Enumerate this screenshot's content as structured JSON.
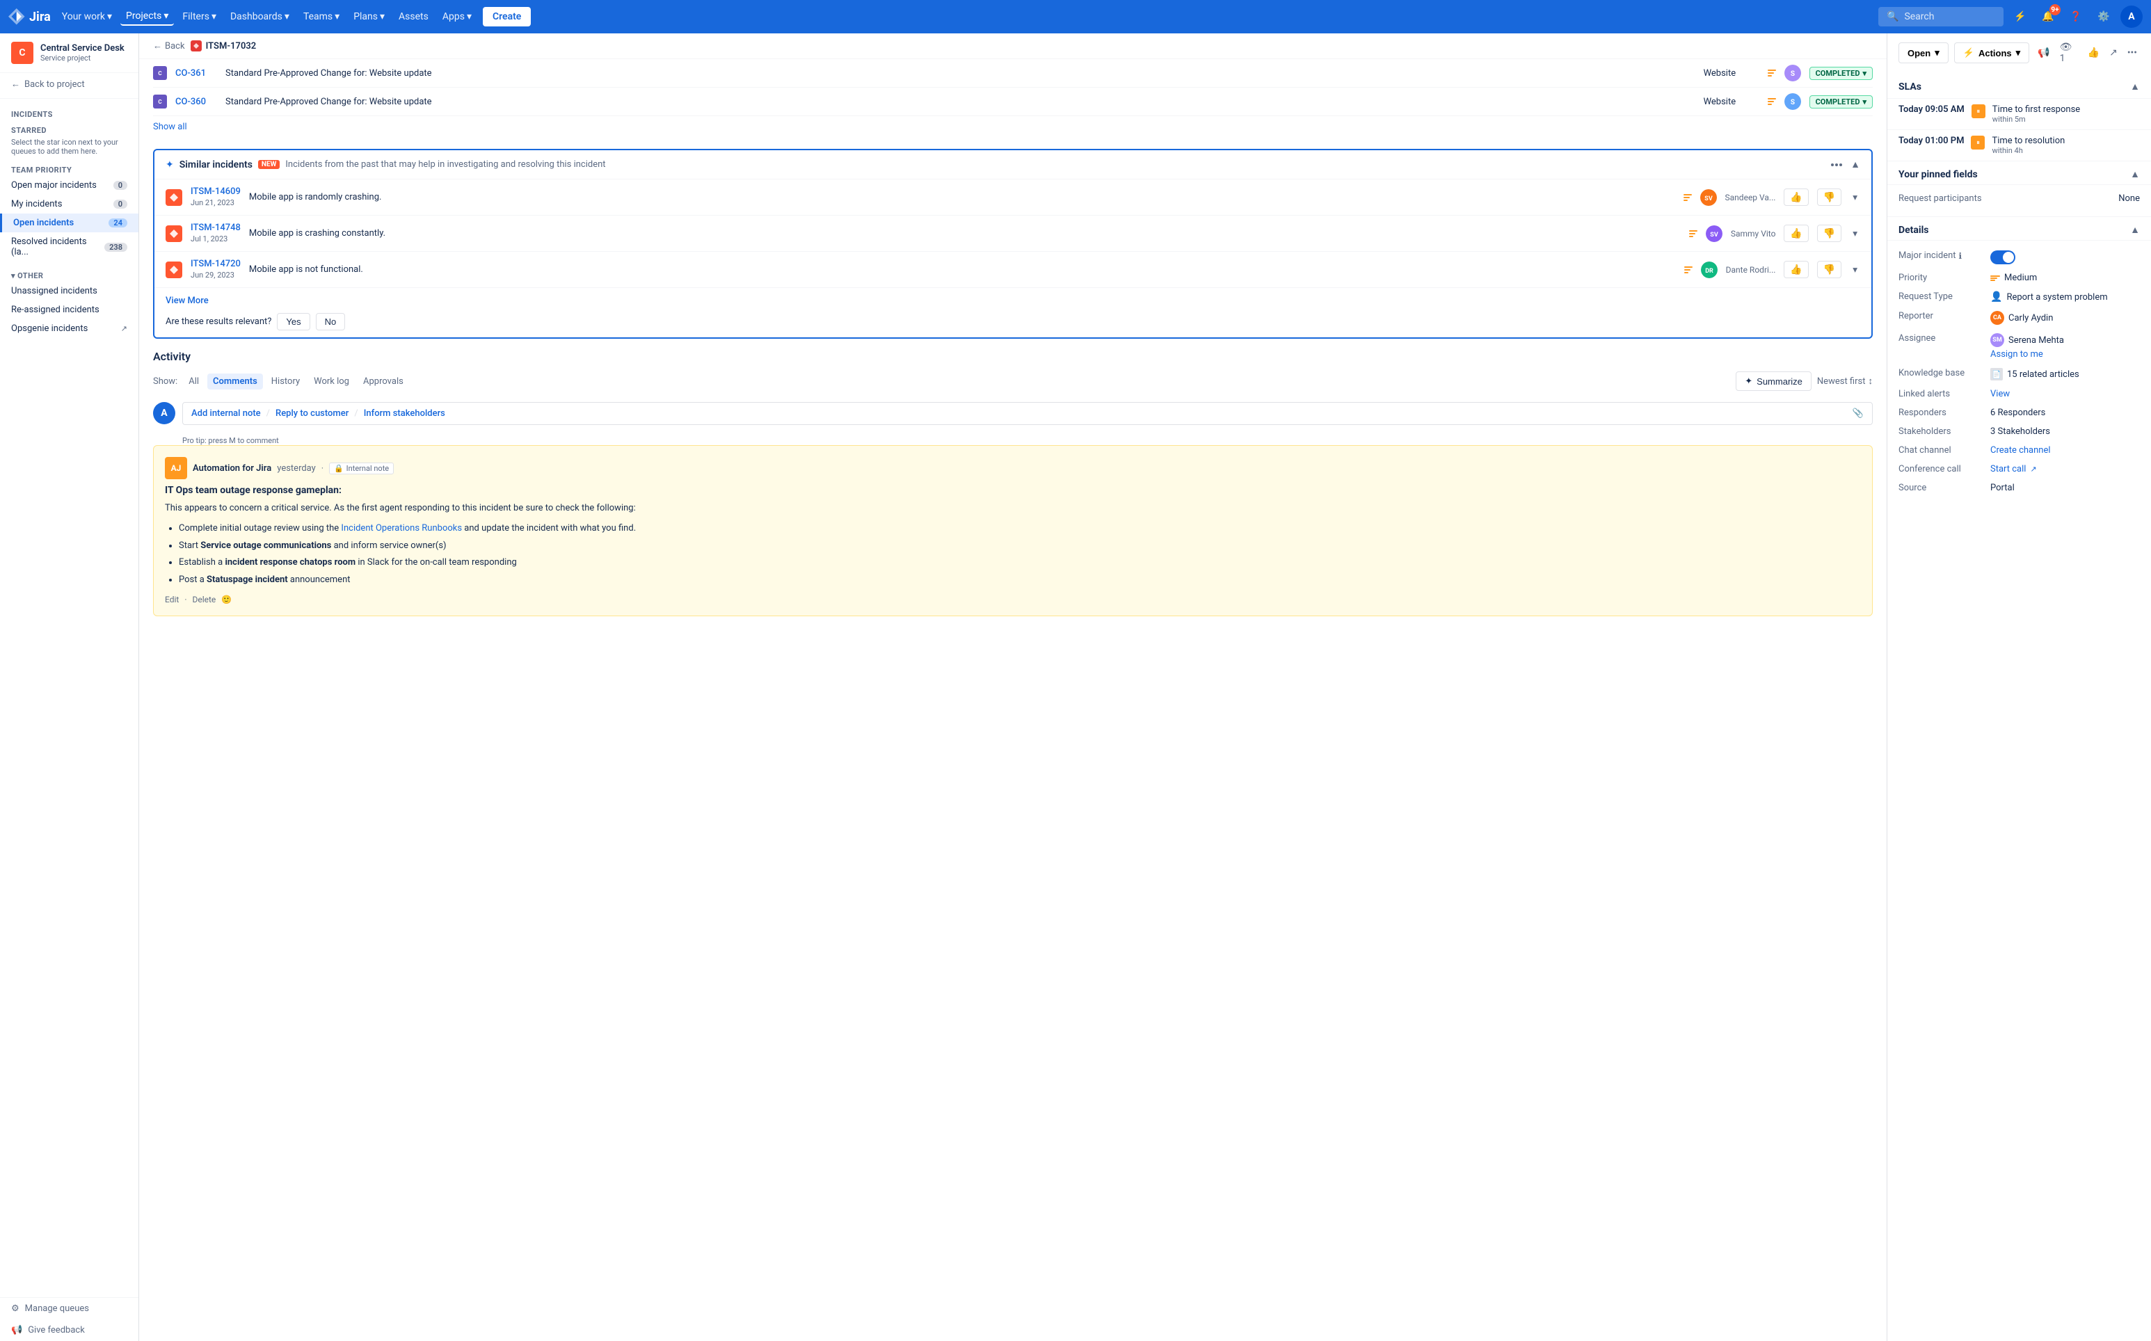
{
  "topnav": {
    "logo_text": "Jira",
    "your_work": "Your work",
    "projects": "Projects",
    "filters": "Filters",
    "dashboards": "Dashboards",
    "teams": "Teams",
    "plans": "Plans",
    "assets": "Assets",
    "apps": "Apps",
    "create": "Create",
    "search_placeholder": "Search",
    "notification_count": "9+"
  },
  "sidebar": {
    "project_name": "Central Service Desk",
    "project_type": "Service project",
    "back_to_project": "Back to project",
    "incidents_title": "Incidents",
    "starred_label": "STARRED",
    "starred_desc": "Select the star icon next to your queues to add them here.",
    "team_priority_label": "TEAM PRIORITY",
    "open_major_incidents": "Open major incidents",
    "open_major_count": "0",
    "my_incidents": "My incidents",
    "my_incidents_count": "0",
    "open_incidents": "Open incidents",
    "open_incidents_count": "24",
    "resolved_incidents": "Resolved incidents (la...",
    "resolved_count": "238",
    "other_label": "OTHER",
    "unassigned_incidents": "Unassigned incidents",
    "reassigned_incidents": "Re-assigned incidents",
    "opsgenie_incidents": "Opsgenie incidents",
    "manage_queues": "Manage queues",
    "give_feedback": "Give feedback"
  },
  "breadcrumb": {
    "back": "Back",
    "ticket_id": "ITSM-17032"
  },
  "changes": [
    {
      "id": "CO-361",
      "title": "Standard Pre-Approved Change for: Website update",
      "category": "Website",
      "status": "COMPLETED"
    },
    {
      "id": "CO-360",
      "title": "Standard Pre-Approved Change for: Website update",
      "category": "Website",
      "status": "COMPLETED"
    }
  ],
  "show_all": "Show all",
  "similar_incidents": {
    "title": "Similar incidents",
    "badge": "NEW",
    "description": "Incidents from the past that may help in investigating and resolving this incident",
    "items": [
      {
        "id": "ITSM-14609",
        "date": "Jun 21, 2023",
        "title": "Mobile app is randomly crashing.",
        "assignee": "Sandeep Va..."
      },
      {
        "id": "ITSM-14748",
        "date": "Jul 1, 2023",
        "title": "Mobile app is crashing constantly.",
        "assignee": "Sammy Vito"
      },
      {
        "id": "ITSM-14720",
        "date": "Jun 29, 2023",
        "title": "Mobile app is not functional.",
        "assignee": "Dante Rodri..."
      }
    ],
    "view_more": "View More",
    "relevance_question": "Are these results relevant?",
    "yes": "Yes",
    "no": "No"
  },
  "activity": {
    "title": "Activity",
    "show_label": "Show:",
    "tabs": [
      "All",
      "Comments",
      "History",
      "Work log",
      "Approvals"
    ],
    "active_tab": "Comments",
    "summarize": "Summarize",
    "newest_first": "Newest first",
    "add_internal_note": "Add internal note",
    "reply_to_customer": "Reply to customer",
    "inform_stakeholders": "Inform stakeholders",
    "pro_tip": "Pro tip: press M to comment"
  },
  "note": {
    "avatar": "AJ",
    "author": "Automation for Jira",
    "time": "yesterday",
    "type": "Internal note",
    "title": "IT Ops team outage response gameplan:",
    "intro": "This appears to concern a critical service. As the first agent responding to this incident be sure to check the following:",
    "items": [
      "Complete initial outage review using the Incident Operations Runbooks and update the incident with what you find.",
      "Start Service outage communications and inform service owner(s)",
      "Establish a incident response chatops room in Slack for the on-call team responding",
      "Post a Statuspage incident announcement"
    ],
    "footer_edit": "Edit",
    "footer_delete": "Delete"
  },
  "right_panel": {
    "open_label": "Open",
    "actions_label": "Actions",
    "slas_title": "SLAs",
    "sla_items": [
      {
        "time": "Today 09:05 AM",
        "label": "Time to first response",
        "sublabel": "within 5m"
      },
      {
        "time": "Today 01:00 PM",
        "label": "Time to resolution",
        "sublabel": "within 4h"
      }
    ],
    "pinned_fields_title": "Your pinned fields",
    "request_participants_label": "Request participants",
    "request_participants_value": "None",
    "details_title": "Details",
    "major_incident_label": "Major incident",
    "major_incident_value": "on",
    "priority_label": "Priority",
    "priority_value": "Medium",
    "request_type_label": "Request Type",
    "request_type_value": "Report a system problem",
    "reporter_label": "Reporter",
    "reporter_value": "Carly Aydin",
    "assignee_label": "Assignee",
    "assignee_value": "Serena Mehta",
    "assign_to_me": "Assign to me",
    "knowledge_base_label": "Knowledge base",
    "knowledge_base_value": "15 related articles",
    "linked_alerts_label": "Linked alerts",
    "linked_alerts_value": "View",
    "responders_label": "Responders",
    "responders_value": "6 Responders",
    "stakeholders_label": "Stakeholders",
    "stakeholders_value": "3 Stakeholders",
    "chat_channel_label": "Chat channel",
    "chat_channel_value": "Create channel",
    "conference_call_label": "Conference call",
    "conference_call_value": "Start call",
    "source_label": "Source",
    "source_value": "Portal"
  },
  "colors": {
    "accent_blue": "#1868db",
    "status_green_bg": "#e3fcef",
    "status_green_text": "#006644",
    "priority_orange": "#ff991f",
    "incident_red": "#ff5630",
    "note_bg": "#fffbe6"
  }
}
